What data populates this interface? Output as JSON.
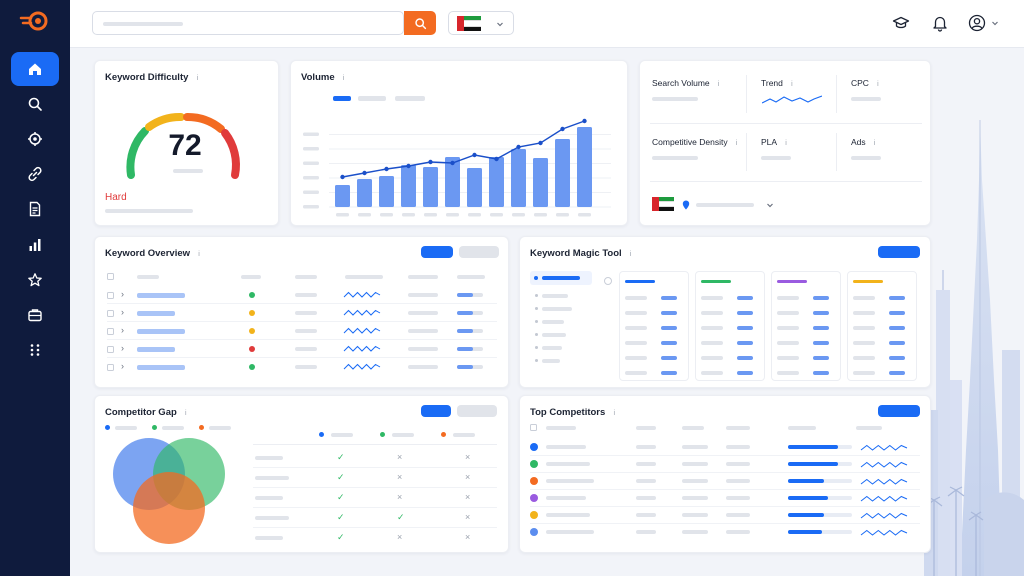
{
  "colors": {
    "sidebar": "#0f1b3d",
    "accent": "#1a6bf5",
    "search_button": "#f36b21",
    "hard_label": "#e03b3b"
  },
  "sidebar": {
    "items": [
      {
        "icon": "home-icon",
        "active": true
      },
      {
        "icon": "search-icon"
      },
      {
        "icon": "target-icon"
      },
      {
        "icon": "link-icon"
      },
      {
        "icon": "document-icon"
      },
      {
        "icon": "bar-chart-icon"
      },
      {
        "icon": "star-icon"
      },
      {
        "icon": "briefcase-icon"
      },
      {
        "icon": "grid-icon"
      }
    ]
  },
  "topbar": {
    "country_flag": "UAE",
    "icons": [
      "graduation-cap-icon",
      "bell-icon",
      "user-icon"
    ]
  },
  "keyword_difficulty": {
    "title": "Keyword Difficulty",
    "score": "72",
    "level": "Hard"
  },
  "volume": {
    "title": "Volume",
    "chart_data": {
      "type": "bar",
      "bars": [
        22,
        28,
        31,
        42,
        40,
        50,
        39,
        50,
        58,
        49,
        68,
        80
      ],
      "line": [
        30,
        34,
        38,
        41,
        45,
        44,
        52,
        48,
        60,
        64,
        78,
        86
      ],
      "ylim": [
        0,
        100
      ]
    }
  },
  "metrics": {
    "search_volume": "Search Volume",
    "trend": "Trend",
    "cpc": "CPC",
    "competitive_density": "Competitive Density",
    "pla": "PLA",
    "ads": "Ads"
  },
  "keyword_overview": {
    "title": "Keyword Overview",
    "row_status_colors": [
      "#2fb865",
      "#f2b31b",
      "#f2b31b",
      "#e03b3b",
      "#2fb865"
    ]
  },
  "keyword_magic_tool": {
    "title": "Keyword Magic Tool",
    "group_colors": [
      "#1a6bf5",
      "#2fb865",
      "#9a5be0",
      "#f2b31b"
    ]
  },
  "competitor_gap": {
    "title": "Competitor Gap",
    "legend_colors": [
      "#1a6bf5",
      "#2fb865",
      "#f36b21"
    ],
    "rows": [
      [
        "check",
        "cross",
        "cross"
      ],
      [
        "check",
        "cross",
        "cross"
      ],
      [
        "check",
        "cross",
        "cross"
      ],
      [
        "check",
        "check",
        "cross"
      ],
      [
        "check",
        "cross",
        "cross"
      ]
    ]
  },
  "top_competitors": {
    "title": "Top Competitors",
    "dot_colors": [
      "#1a6bf5",
      "#2fb865",
      "#f36b21",
      "#9a5be0",
      "#f2b31b",
      "#5b8def"
    ]
  }
}
